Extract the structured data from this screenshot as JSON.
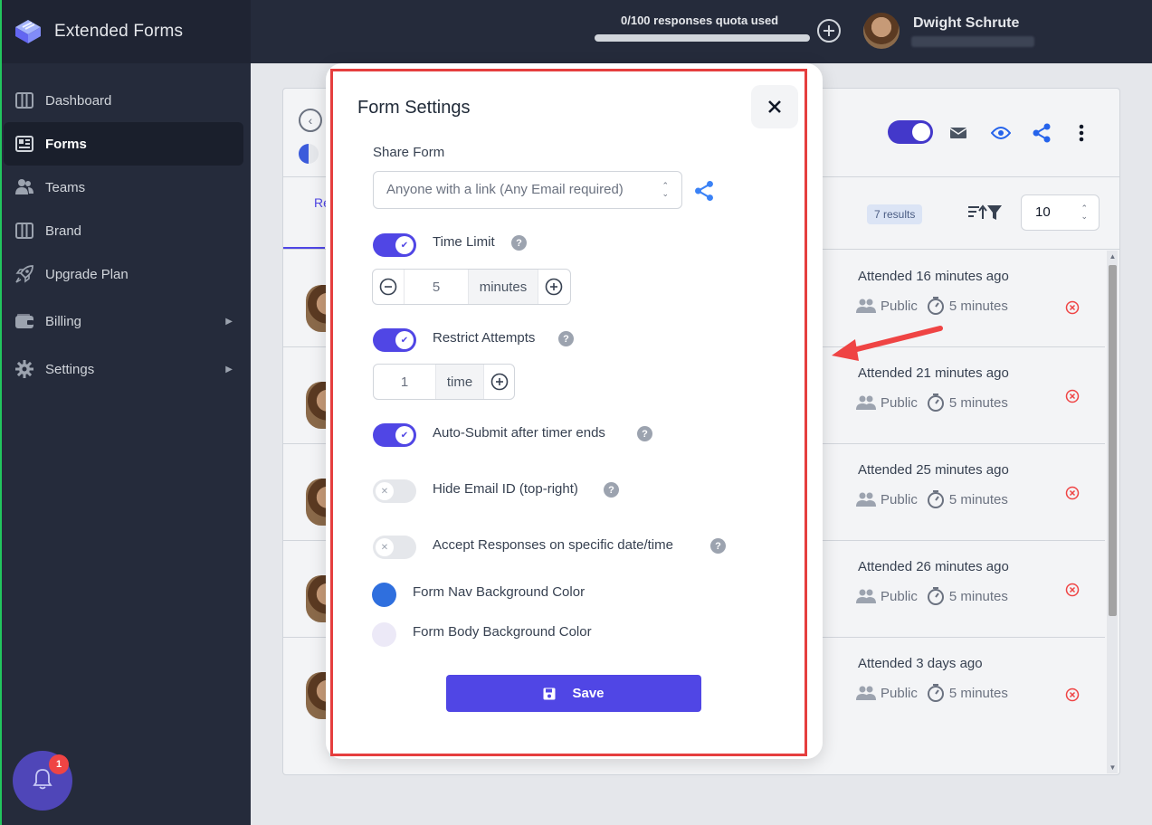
{
  "app": {
    "name": "Extended Forms"
  },
  "sidebar": {
    "items": [
      {
        "label": "Dashboard",
        "icon": "columns-icon"
      },
      {
        "label": "Forms",
        "icon": "document-icon",
        "active": true
      },
      {
        "label": "Teams",
        "icon": "users-icon"
      },
      {
        "label": "Brand",
        "icon": "columns-icon"
      },
      {
        "label": "Upgrade Plan",
        "icon": "rocket-icon"
      },
      {
        "label": "Billing",
        "icon": "wallet-icon",
        "submenu": true
      },
      {
        "label": "Settings",
        "icon": "gear-icon",
        "submenu": true
      }
    ],
    "notifications_count": "1"
  },
  "topbar": {
    "quota_text": "0/100 responses quota used",
    "quota_progress": 0,
    "user_name": "Dwight Schrute"
  },
  "card": {
    "tab_fragment": "Re",
    "results_badge": "7 results",
    "per_page": "10",
    "rows": [
      {
        "attended": "Attended 16 minutes ago",
        "visibility": "Public",
        "duration": "5 minutes"
      },
      {
        "attended": "Attended 21 minutes ago",
        "visibility": "Public",
        "duration": "5 minutes"
      },
      {
        "attended": "Attended 25 minutes ago",
        "visibility": "Public",
        "duration": "5 minutes"
      },
      {
        "attended": "Attended 26 minutes ago",
        "visibility": "Public",
        "duration": "5 minutes"
      },
      {
        "attended": "Attended 3 days ago",
        "visibility": "Public",
        "duration": "5 minutes"
      }
    ]
  },
  "modal": {
    "title": "Form Settings",
    "share_form_label": "Share Form",
    "share_form_value": "Anyone with a link (Any Email required)",
    "time_limit": {
      "label": "Time Limit",
      "enabled": true,
      "value": "5",
      "unit": "minutes"
    },
    "restrict_attempts": {
      "label": "Restrict Attempts",
      "enabled": true,
      "value": "1",
      "unit": "time"
    },
    "auto_submit": {
      "label": "Auto-Submit after timer ends",
      "enabled": true
    },
    "hide_email": {
      "label": "Hide Email ID (top-right)",
      "enabled": false
    },
    "accept_responses": {
      "label": "Accept Responses on specific date/time",
      "enabled": false
    },
    "nav_color": {
      "label": "Form Nav Background Color",
      "color": "#2f6fde"
    },
    "body_color": {
      "label": "Form Body Background Color",
      "color": "#ece9f7"
    },
    "save_label": "Save"
  },
  "colors": {
    "accent": "#5046e5",
    "sidebar_bg": "#252b3b",
    "highlight": "#e53e3e"
  }
}
